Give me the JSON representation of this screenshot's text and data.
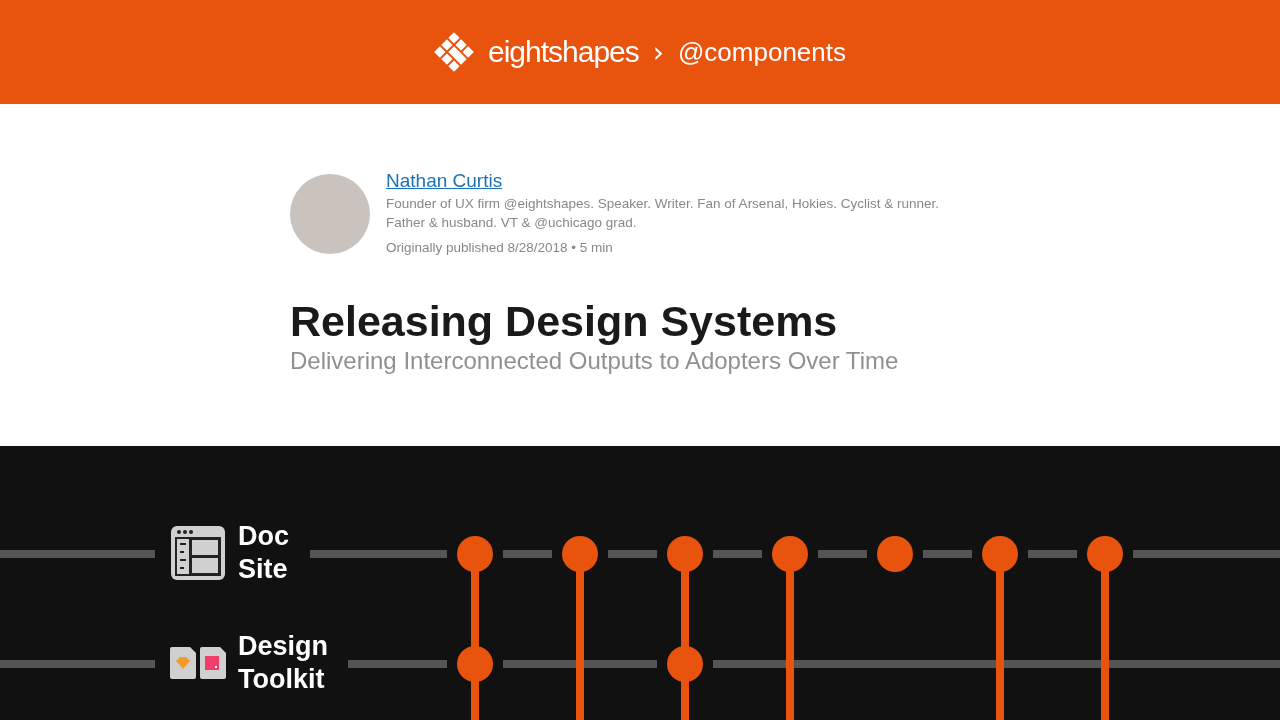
{
  "header": {
    "brand": "eightshapes",
    "separator": "›",
    "section": "@components"
  },
  "author": {
    "name": "Nathan Curtis",
    "bio": "Founder of UX firm @eightshapes. Speaker. Writer. Fan of Arsenal, Hokies. Cyclist & runner. Father & husband. VT & @uchicago grad.",
    "meta": "Originally published 8/28/2018 • 5 min"
  },
  "article": {
    "title": "Releasing Design Systems",
    "subtitle": "Delivering Interconnected Outputs to Adopters Over Time"
  },
  "tracks": [
    {
      "kind": "doc",
      "label": "Doc Site"
    },
    {
      "kind": "toolkit",
      "label": "Design Toolkit"
    }
  ],
  "releases": [
    {
      "doc": true,
      "toolkit": true,
      "continues": true
    },
    {
      "doc": true,
      "toolkit": false,
      "continues": true
    },
    {
      "doc": true,
      "toolkit": true,
      "continues": true
    },
    {
      "doc": true,
      "toolkit": false,
      "continues": true
    },
    {
      "doc": true,
      "toolkit": false,
      "continues": false
    },
    {
      "doc": true,
      "toolkit": false,
      "continues": true
    },
    {
      "doc": true,
      "toolkit": false,
      "continues": true
    }
  ]
}
